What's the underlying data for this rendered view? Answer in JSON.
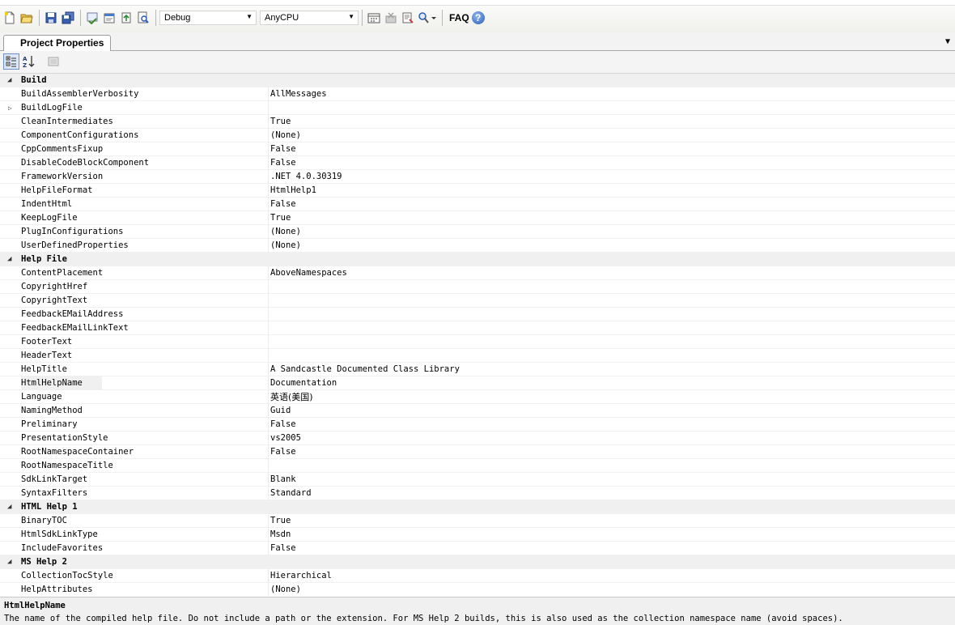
{
  "toolbar": {
    "config": "Debug",
    "platform": "AnyCPU",
    "faq": "FAQ",
    "help": "?"
  },
  "tab": {
    "label": "Project Properties"
  },
  "grid": {
    "rows": [
      {
        "type": "cat",
        "name": "Build"
      },
      {
        "type": "prop",
        "name": "BuildAssemblerVerbosity",
        "value": "AllMessages"
      },
      {
        "type": "prop",
        "name": "BuildLogFile",
        "value": "",
        "expandable": true
      },
      {
        "type": "prop",
        "name": "CleanIntermediates",
        "value": "True"
      },
      {
        "type": "prop",
        "name": "ComponentConfigurations",
        "value": "(None)"
      },
      {
        "type": "prop",
        "name": "CppCommentsFixup",
        "value": "False"
      },
      {
        "type": "prop",
        "name": "DisableCodeBlockComponent",
        "value": "False"
      },
      {
        "type": "prop",
        "name": "FrameworkVersion",
        "value": ".NET 4.0.30319"
      },
      {
        "type": "prop",
        "name": "HelpFileFormat",
        "value": "HtmlHelp1"
      },
      {
        "type": "prop",
        "name": "IndentHtml",
        "value": "False"
      },
      {
        "type": "prop",
        "name": "KeepLogFile",
        "value": "True"
      },
      {
        "type": "prop",
        "name": "PlugInConfigurations",
        "value": "(None)"
      },
      {
        "type": "prop",
        "name": "UserDefinedProperties",
        "value": "(None)"
      },
      {
        "type": "cat",
        "name": "Help File"
      },
      {
        "type": "prop",
        "name": "ContentPlacement",
        "value": "AboveNamespaces"
      },
      {
        "type": "prop",
        "name": "CopyrightHref",
        "value": ""
      },
      {
        "type": "prop",
        "name": "CopyrightText",
        "value": ""
      },
      {
        "type": "prop",
        "name": "FeedbackEMailAddress",
        "value": ""
      },
      {
        "type": "prop",
        "name": "FeedbackEMailLinkText",
        "value": ""
      },
      {
        "type": "prop",
        "name": "FooterText",
        "value": ""
      },
      {
        "type": "prop",
        "name": "HeaderText",
        "value": ""
      },
      {
        "type": "prop",
        "name": "HelpTitle",
        "value": "A Sandcastle Documented Class Library"
      },
      {
        "type": "prop",
        "name": "HtmlHelpName",
        "value": "Documentation",
        "selected": true
      },
      {
        "type": "prop",
        "name": "Language",
        "value": "英语(美国)",
        "cjk": true
      },
      {
        "type": "prop",
        "name": "NamingMethod",
        "value": "Guid"
      },
      {
        "type": "prop",
        "name": "Preliminary",
        "value": "False"
      },
      {
        "type": "prop",
        "name": "PresentationStyle",
        "value": "vs2005"
      },
      {
        "type": "prop",
        "name": "RootNamespaceContainer",
        "value": "False"
      },
      {
        "type": "prop",
        "name": "RootNamespaceTitle",
        "value": ""
      },
      {
        "type": "prop",
        "name": "SdkLinkTarget",
        "value": "Blank"
      },
      {
        "type": "prop",
        "name": "SyntaxFilters",
        "value": "Standard"
      },
      {
        "type": "cat",
        "name": "HTML Help 1"
      },
      {
        "type": "prop",
        "name": "BinaryTOC",
        "value": "True"
      },
      {
        "type": "prop",
        "name": "HtmlSdkLinkType",
        "value": "Msdn"
      },
      {
        "type": "prop",
        "name": "IncludeFavorites",
        "value": "False"
      },
      {
        "type": "cat",
        "name": "MS Help 2"
      },
      {
        "type": "prop",
        "name": "CollectionTocStyle",
        "value": "Hierarchical"
      },
      {
        "type": "prop",
        "name": "HelpAttributes",
        "value": "(None)"
      }
    ]
  },
  "description": {
    "title": "HtmlHelpName",
    "text": "The name of the compiled help file.  Do not include a path or the extension.  For MS Help 2 builds, this is also used as the collection namespace name (avoid spaces)."
  }
}
